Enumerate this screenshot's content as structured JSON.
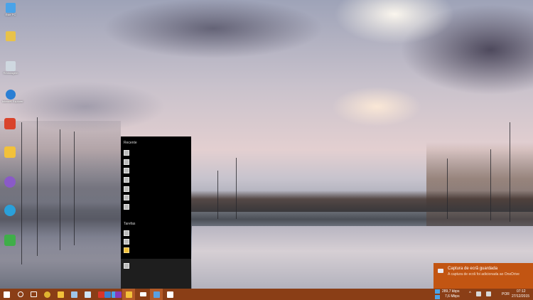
{
  "desktop": {
    "icons": [
      {
        "label": "Este PC",
        "icon": "computer-icon",
        "color": "#4aa3e8"
      },
      {
        "label": "",
        "icon": "user-folder-icon",
        "color": "#e8c24a"
      },
      {
        "label": "Reciclagem",
        "icon": "recycle-bin-icon",
        "color": "#cfd8e0"
      },
      {
        "label": "Internet Explorer",
        "icon": "internet-explorer-icon",
        "color": "#2a7fd4"
      }
    ],
    "side_icons": [
      {
        "icon": "app-icon-red",
        "color": "#d9432b"
      },
      {
        "icon": "folder-icon",
        "color": "#f2c13a"
      },
      {
        "icon": "purple-app-icon",
        "color": "#8a5ac8"
      },
      {
        "icon": "telegram-icon",
        "color": "#2aa0da"
      },
      {
        "icon": "green-app-icon",
        "color": "#3fae49"
      }
    ]
  },
  "jump_list": {
    "recent_heading": "Recente",
    "tasks_heading": "Tarefas",
    "recent_count_items": [
      1,
      2,
      3,
      4,
      5,
      6,
      7
    ],
    "task_items": [
      1,
      2
    ]
  },
  "taskbar": {
    "color": "#8a3e16",
    "buttons": [
      {
        "icon": "start-icon",
        "color": "#ffffff"
      },
      {
        "icon": "search-icon",
        "color": "#ffffff"
      },
      {
        "icon": "task-view-icon",
        "color": "#ffffff"
      },
      {
        "icon": "chrome-icon",
        "color": "#e0b530"
      },
      {
        "icon": "file-explorer-icon",
        "color": "#f2c13a"
      },
      {
        "icon": "mail-icon",
        "color": "#9fc5e8"
      },
      {
        "icon": "store-icon",
        "color": "#cde4f7"
      },
      {
        "icon": "acrobat-icon",
        "color": "#d9362b"
      },
      {
        "icon": "app-blue-icon",
        "color": "#4aa3e8"
      },
      {
        "icon": "outlook-icon",
        "color": "#3a7fd0"
      },
      {
        "icon": "onenote-icon",
        "color": "#8a3ab8"
      },
      {
        "icon": "active-app-icon",
        "color": "#f2c13a"
      },
      {
        "icon": "envelope-icon",
        "color": "#ffffff"
      },
      {
        "icon": "photos-icon",
        "color": "#5aa0e0"
      },
      {
        "icon": "screen-app-icon",
        "color": "#ffffff"
      }
    ],
    "tray": {
      "upload_speed": "289,7 kbps",
      "download_speed": "7,6 Mbps",
      "language": "POR",
      "time": "07:12",
      "date": "27/12/2015"
    }
  },
  "toast": {
    "title": "Captura de ecrã guardada",
    "body": "A captura de ecrã foi adicionada ao OneDrive",
    "color": "#c25512"
  }
}
